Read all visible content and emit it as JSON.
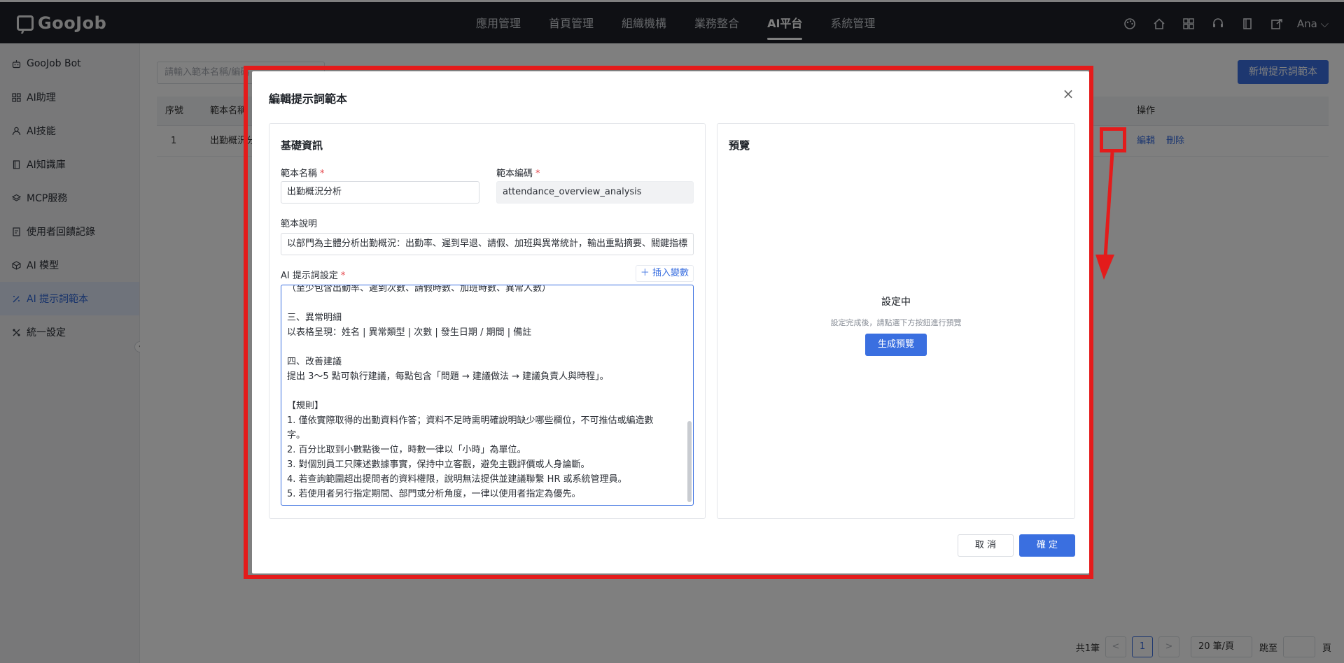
{
  "app": {
    "logo_text": "GooJob"
  },
  "topnav": {
    "items": [
      {
        "label": "應用管理",
        "active": false
      },
      {
        "label": "首頁管理",
        "active": false
      },
      {
        "label": "組織機構",
        "active": false
      },
      {
        "label": "業務整合",
        "active": false
      },
      {
        "label": "AI平台",
        "active": true
      },
      {
        "label": "系統管理",
        "active": false
      }
    ],
    "icons": [
      "palette-icon",
      "home-icon",
      "apps-grid-icon",
      "support-icon",
      "book-icon",
      "export-icon"
    ],
    "user": "Ana"
  },
  "sidebar": {
    "items": [
      {
        "label": "GooJob Bot",
        "icon": "bot-icon",
        "active": false
      },
      {
        "label": "AI助理",
        "icon": "grid-icon",
        "active": false
      },
      {
        "label": "AI技能",
        "icon": "user-skill-icon",
        "active": false
      },
      {
        "label": "AI知識庫",
        "icon": "book-icon",
        "active": false
      },
      {
        "label": "MCP服務",
        "icon": "layers-icon",
        "active": false
      },
      {
        "label": "使用者回饋記錄",
        "icon": "feedback-icon",
        "active": false
      },
      {
        "label": "AI 模型",
        "icon": "cube-icon",
        "active": false
      },
      {
        "label": "AI 提示詞範本",
        "icon": "magic-wand-icon",
        "active": true
      },
      {
        "label": "統一設定",
        "icon": "settings-icon",
        "active": false
      }
    ]
  },
  "main": {
    "search_placeholder": "請輸入範本名稱/編碼",
    "new_button": "新增提示詞範本",
    "table": {
      "headers": {
        "index": "序號",
        "name": "範本名稱",
        "action": "操作"
      },
      "rows": [
        {
          "index": "1",
          "name": "出勤概況分析",
          "edit": "編輯",
          "delete": "刪除"
        }
      ]
    },
    "pager": {
      "total": "共1筆",
      "prev": "<",
      "page": "1",
      "next": ">",
      "page_size": "20 筆/頁",
      "jump_label": "跳至",
      "unit": "頁"
    }
  },
  "modal": {
    "title": "編輯提示詞範本",
    "close": "×",
    "basic": {
      "title": "基礎資訊",
      "name_label": "範本名稱",
      "name_value": "出勤概況分析",
      "code_label": "範本編碼",
      "code_value": "attendance_overview_analysis",
      "desc_label": "範本說明",
      "desc_value": "以部門為主體分析出勤概況：出勤率、遲到早退、請假、加班與異常統計，輸出重點摘要、關鍵指標",
      "prompt_label": "AI 提示詞設定",
      "insert_var": "插入變數",
      "prompt_lines": [
        "（至少包含出勤率、遲到次數、請假時數、加班時數、異常人數）",
        "",
        "三、異常明細",
        "以表格呈現：姓名 | 異常類型 | 次數 | 發生日期 / 期間 | 備註",
        "",
        "四、改善建議",
        "提出 3～5 點可執行建議，每點包含「問題 → 建議做法 → 建議負責人與時程」。",
        "",
        "【規則】",
        "1. 僅依實際取得的出勤資料作答；資料不足時需明確說明缺少哪些欄位，不可推估或編造數",
        "字。",
        "2. 百分比取到小數點後一位，時數一律以「小時」為單位。",
        "3. 對個別員工只陳述數據事實，保持中立客觀，避免主觀評價或人身論斷。",
        "4. 若查詢範圍超出提問者的資料權限，說明無法提供並建議聯繫 HR 或系統管理員。",
        "5. 若使用者另行指定期間、部門或分析角度，一律以使用者指定為優先。"
      ]
    },
    "preview": {
      "title": "預覽",
      "status": "設定中",
      "hint": "設定完成後，請點選下方按鈕進行預覽",
      "generate": "生成預覽"
    },
    "cancel": "取 消",
    "confirm": "確 定"
  },
  "colors": {
    "accent": "#3a6fe0",
    "annotation": "#e41b1b",
    "topbar": "#1e2128"
  }
}
